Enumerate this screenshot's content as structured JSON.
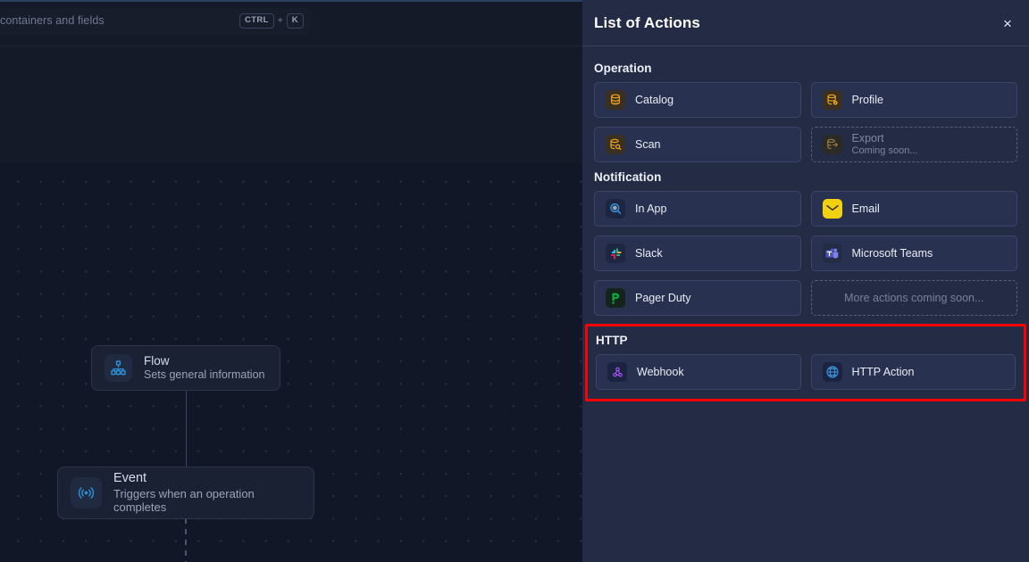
{
  "canvas": {
    "search": {
      "placeholder": "containers and fields",
      "shortcut_key1": "CTRL",
      "shortcut_plus": "+",
      "shortcut_key2": "K"
    },
    "nodes": [
      {
        "title": "Flow",
        "subtitle": "Sets general information",
        "icon": "org-chart-icon"
      },
      {
        "title": "Event",
        "subtitle": "Triggers when an operation completes",
        "icon": "broadcast-icon"
      }
    ]
  },
  "panel": {
    "title": "List of Actions",
    "close_label": "×",
    "sections": [
      {
        "title": "Operation",
        "highlight": false,
        "cards": [
          {
            "label": "Catalog",
            "sub": "",
            "icon": "database-icon",
            "state": "enabled"
          },
          {
            "label": "Profile",
            "sub": "",
            "icon": "database-profile-icon",
            "state": "enabled"
          },
          {
            "label": "Scan",
            "sub": "",
            "icon": "database-scan-icon",
            "state": "enabled"
          },
          {
            "label": "Export",
            "sub": "Coming soon...",
            "icon": "database-export-icon",
            "state": "disabled"
          }
        ]
      },
      {
        "title": "Notification",
        "highlight": false,
        "cards": [
          {
            "label": "In App",
            "sub": "",
            "icon": "in-app-icon",
            "state": "enabled"
          },
          {
            "label": "Email",
            "sub": "",
            "icon": "email-icon",
            "state": "enabled"
          },
          {
            "label": "Slack",
            "sub": "",
            "icon": "slack-icon",
            "state": "enabled"
          },
          {
            "label": "Microsoft Teams",
            "sub": "",
            "icon": "microsoft-teams-icon",
            "state": "enabled"
          },
          {
            "label": "Pager Duty",
            "sub": "",
            "icon": "pagerduty-icon",
            "state": "enabled"
          },
          {
            "label": "More actions coming soon...",
            "sub": "",
            "icon": "",
            "state": "empty"
          }
        ]
      },
      {
        "title": "HTTP",
        "highlight": true,
        "cards": [
          {
            "label": "Webhook",
            "sub": "",
            "icon": "webhook-icon",
            "state": "enabled"
          },
          {
            "label": "HTTP Action",
            "sub": "",
            "icon": "globe-icon",
            "state": "enabled"
          }
        ]
      }
    ]
  },
  "colors": {
    "highlight_box": "#ff0000",
    "panel_bg": "#232b45",
    "canvas_bg": "#111726",
    "accent_amber": "#f5a623",
    "accent_blue": "#2f8fd6"
  }
}
